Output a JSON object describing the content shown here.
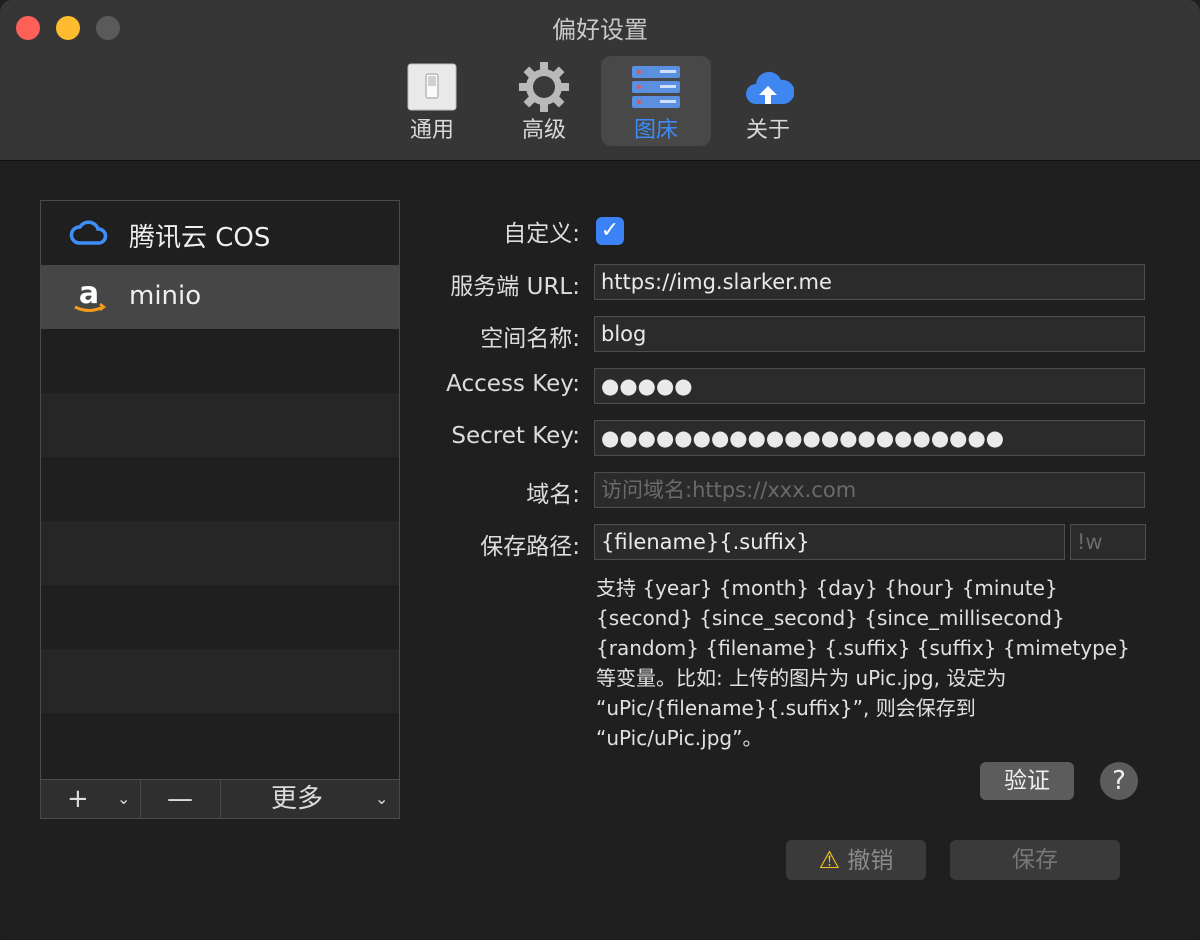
{
  "window": {
    "title": "偏好设置"
  },
  "tabs": [
    {
      "label": "通用",
      "icon": "switch-icon"
    },
    {
      "label": "高级",
      "icon": "gear-icon"
    },
    {
      "label": "图床",
      "icon": "server-icon",
      "active": true
    },
    {
      "label": "关于",
      "icon": "cloud-upload-icon"
    }
  ],
  "hosts": [
    {
      "label": "腾讯云 COS",
      "icon": "tencent-cloud-icon"
    },
    {
      "label": "minio",
      "icon": "amazon-icon",
      "selected": true
    }
  ],
  "list_toolbar": {
    "add": "+",
    "remove": "—",
    "more": "更多"
  },
  "form": {
    "custom_label": "自定义:",
    "custom_checked": true,
    "server_url_label": "服务端 URL:",
    "server_url_value": "https://img.slarker.me",
    "bucket_label": "空间名称:",
    "bucket_value": "blog",
    "access_key_label": "Access Key:",
    "access_key_value": "●●●●●",
    "secret_key_label": "Secret Key:",
    "secret_key_value": "●●●●●●●●●●●●●●●●●●●●●●",
    "domain_label": "域名:",
    "domain_placeholder": "访问域名:https://xxx.com",
    "save_path_label": "保存路径:",
    "save_path_value": "{filename}{.suffix}",
    "suffix_placeholder": "!w",
    "help_text": "支持 {year} {month} {day} {hour} {minute} {second} {since_second} {since_millisecond} {random} {filename} {.suffix} {suffix} {mimetype} 等变量。比如: 上传的图片为 uPic.jpg, 设定为 “uPic/{filename}{.suffix}”, 则会保存到 “uPic/uPic.jpg”。"
  },
  "buttons": {
    "verify": "验证",
    "help": "?",
    "revert": "撤销",
    "save": "保存"
  },
  "colors": {
    "accent": "#3b82f6",
    "active_tab_text": "#3b8cf7"
  }
}
